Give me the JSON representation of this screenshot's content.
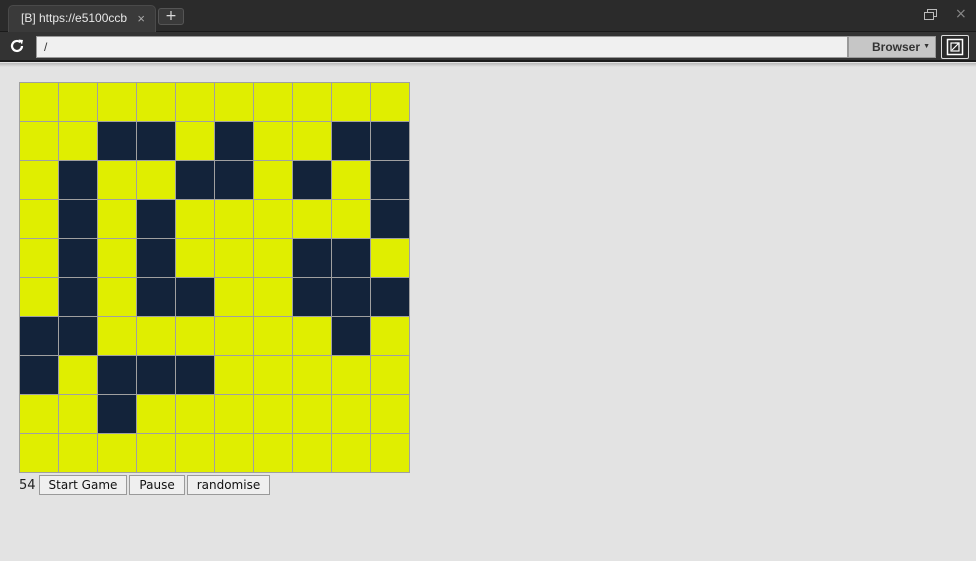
{
  "browser": {
    "tab_title": "[B] https://e5100ccb",
    "tab_close": "×",
    "new_tab": "+",
    "address": "/",
    "browser_menu": "Browser",
    "window_close": "×",
    "icons": [
      "reload-icon",
      "window-restore-icon",
      "extension-icon",
      "chevron-down-icon"
    ]
  },
  "game": {
    "counter": "54",
    "buttons": {
      "start": "Start Game",
      "pause": "Pause",
      "randomise": "randomise"
    },
    "colors": {
      "alive": "#e0ee00",
      "dead": "#13233a",
      "gridline": "#a0a0a0"
    },
    "grid": [
      [
        0,
        0,
        0,
        0,
        0,
        0,
        0,
        0,
        0,
        0
      ],
      [
        0,
        0,
        1,
        1,
        0,
        1,
        0,
        0,
        1,
        1
      ],
      [
        0,
        1,
        0,
        0,
        1,
        1,
        0,
        1,
        0,
        1
      ],
      [
        0,
        1,
        0,
        1,
        0,
        0,
        0,
        0,
        0,
        1
      ],
      [
        0,
        1,
        0,
        1,
        0,
        0,
        0,
        1,
        1,
        0
      ],
      [
        0,
        1,
        0,
        1,
        1,
        0,
        0,
        1,
        1,
        1
      ],
      [
        1,
        1,
        0,
        0,
        0,
        0,
        0,
        0,
        1,
        0
      ],
      [
        1,
        0,
        1,
        1,
        1,
        0,
        0,
        0,
        0,
        0
      ],
      [
        0,
        0,
        1,
        0,
        0,
        0,
        0,
        0,
        0,
        0
      ],
      [
        0,
        0,
        0,
        0,
        0,
        0,
        0,
        0,
        0,
        0
      ]
    ]
  }
}
